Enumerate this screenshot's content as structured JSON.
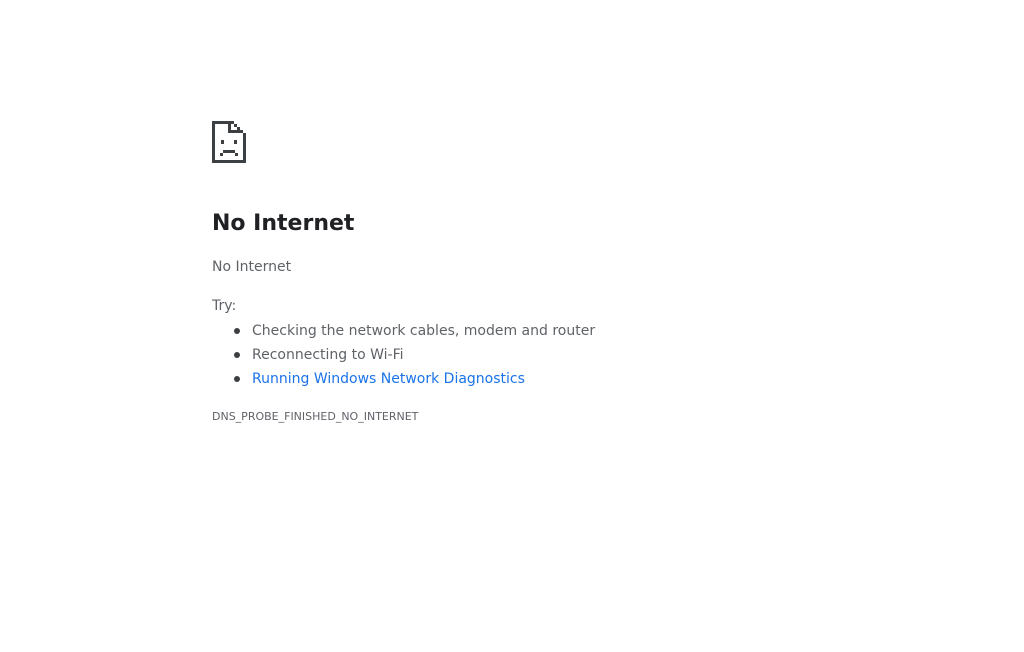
{
  "error_page": {
    "icon": "sad-document-icon",
    "title": "No Internet",
    "subtitle": "No Internet",
    "try_label": "Try:",
    "suggestions": [
      {
        "text": "Checking the network cables, modem and router",
        "link": false
      },
      {
        "text": "Reconnecting to Wi-Fi",
        "link": false
      },
      {
        "text": "Running Windows Network Diagnostics",
        "link": true
      }
    ],
    "error_code": "DNS_PROBE_FINISHED_NO_INTERNET"
  },
  "colors": {
    "title": "#202124",
    "body_text": "#5f6368",
    "link": "#1a73e8",
    "background": "#ffffff"
  }
}
